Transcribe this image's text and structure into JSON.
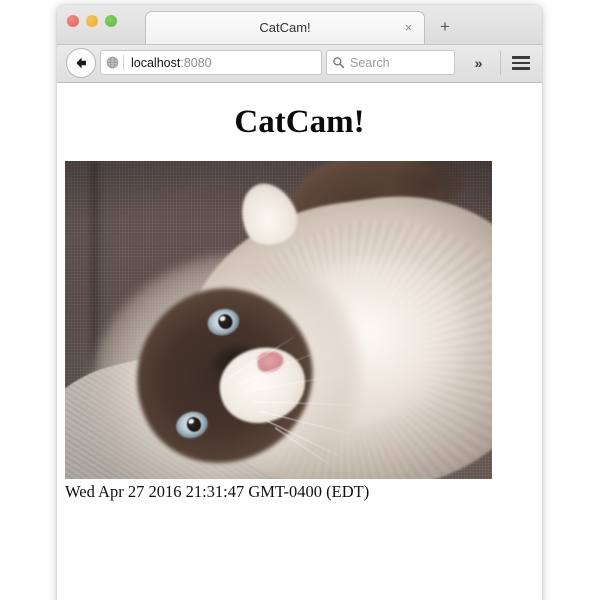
{
  "window": {
    "traffic_lights": [
      {
        "name": "close",
        "color": "#e0655c"
      },
      {
        "name": "minimize",
        "color": "#eaae2e"
      },
      {
        "name": "maximize",
        "color": "#5fb840"
      }
    ]
  },
  "tabbar": {
    "tab_title": "CatCam!",
    "close_label": "×",
    "newtab_label": "+"
  },
  "toolbar": {
    "back_icon": "back-arrow-icon",
    "identity_icon": "globe-icon",
    "url_domain": "localhost",
    "url_rest": ":8080",
    "reload_icon": "reload-icon",
    "search_icon": "search-icon",
    "search_placeholder": "Search",
    "overflow_label": "»",
    "menu_icon": "hamburger-menu-icon"
  },
  "page": {
    "heading": "CatCam!",
    "photo_alt": "cat-photo",
    "timestamp": "Wed Apr 27 2016 21:31:47 GMT-0400 (EDT)"
  }
}
